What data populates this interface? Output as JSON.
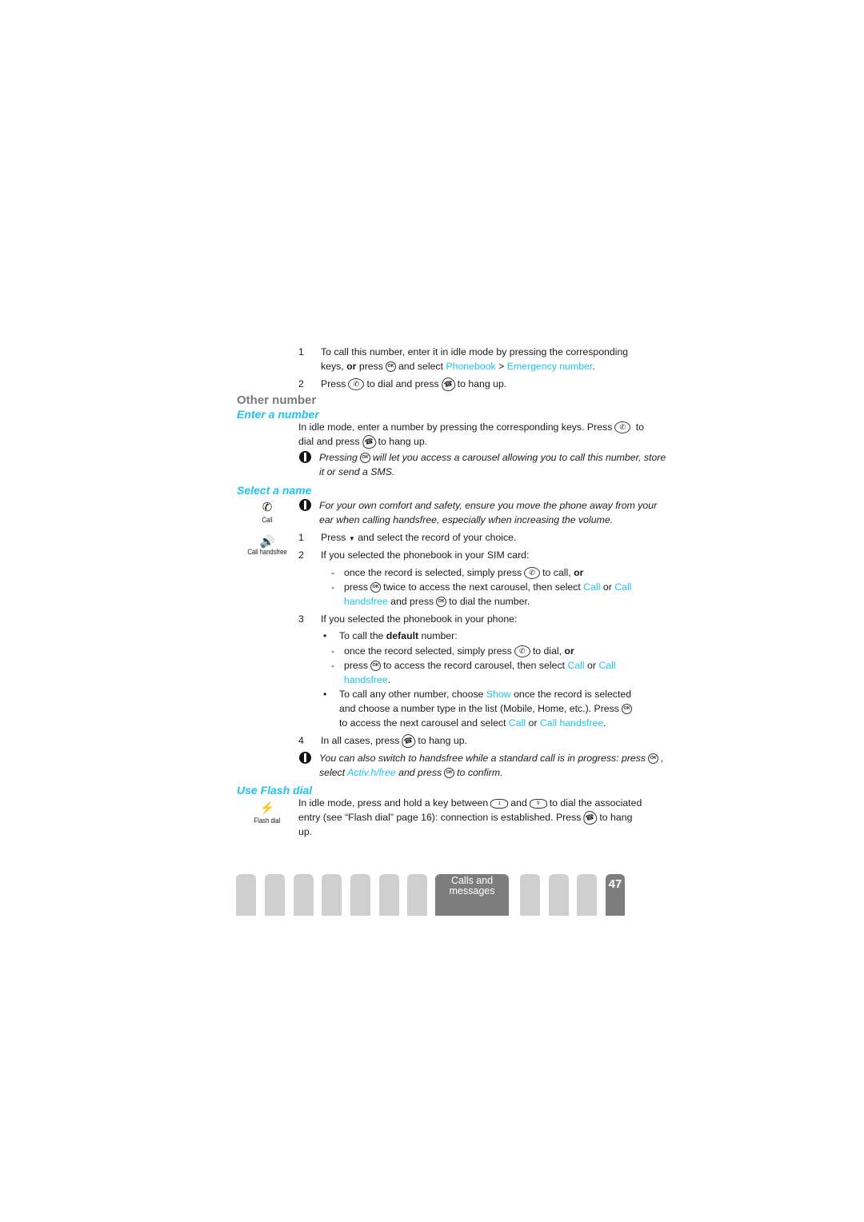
{
  "colors": {
    "accent": "#1fc3ee",
    "heading": "#7a7a7a",
    "tab": "#cfcfcf",
    "tab_active": "#7d7d7d"
  },
  "keys": {
    "ok": "OK",
    "call": "✆",
    "hang": "☎",
    "down": "▼",
    "key1": "1",
    "key9": "9"
  },
  "emergency": {
    "n1": "1",
    "s1a": "To call this number, enter it in idle mode by pressing the corresponding",
    "s1b": "keys,",
    "s1c": "or",
    "s1d": "press",
    "s1e": "and select",
    "s1f": "Phonebook",
    "s1g": ">",
    "s1h": "Emergency number",
    "s1i": ".",
    "n2": "2",
    "s2a": "Press",
    "s2b": "to dial and press",
    "s2c": "to hang up."
  },
  "other": {
    "title": "Other number",
    "enter_title": "Enter a number",
    "p1a": "In idle mode, enter a number by pressing the corresponding keys. Press",
    "p1b": "to",
    "p1c": "dial and press",
    "p1d": "to hang up.",
    "n1a": "Pressing",
    "n1b": "will let you access a carousel allowing you to call this number, store",
    "n1c": "it or send a SMS."
  },
  "select": {
    "title": "Select a name",
    "icon_call": "Call",
    "icon_handsfree": "Call handsfree",
    "note_a": "For your own comfort and safety, ensure you move the phone away from your",
    "note_b": "ear when calling handsfree, especially when increasing the volume.",
    "n1": "1",
    "s1a": "Press",
    "s1b": "and select the record of your choice.",
    "n2": "2",
    "s2": "If you selected the phonebook in your SIM card:",
    "d1a": "once the record is selected, simply press",
    "d1b": "to call,",
    "d1c": "or",
    "d2a": "press",
    "d2b": "twice to access the next carousel, then select",
    "d2c": "Call",
    "d2d": "or",
    "d2e": "Call",
    "d2f": "handsfree",
    "d2g": "and press",
    "d2h": "to  dial the number.",
    "n3": "3",
    "s3": "If you selected the phonebook in your phone:",
    "b1a": "To call the",
    "b1b": "default",
    "b1c": "number:",
    "e1a": "once the record selected, simply press",
    "e1b": "to dial,",
    "e1c": "or",
    "e2a": "press",
    "e2b": "to access the record carousel, then select",
    "e2c": "Call",
    "e2d": "or",
    "e2e": "Call",
    "e2f": "handsfree",
    "b2a": "To call any other number, choose",
    "b2b": "Show",
    "b2c": "once the record is selected",
    "b2d": "and choose a number type in the list (Mobile, Home, etc.). Press",
    "b2e": "to access the next carousel and select",
    "b2f": "Call",
    "b2g": "or",
    "b2h": "Call handsfree",
    "n4": "4",
    "s4a": "In all cases, press",
    "s4b": "to hang up.",
    "n5a": "You can also switch to handsfree while a standard call is in progress: press",
    "n5b": "select",
    "n5c": "Activ.h/free",
    "n5d": "and press",
    "n5e": "to confirm."
  },
  "flash": {
    "title": "Use Flash dial",
    "icon_label": "Flash dial",
    "a": "In idle mode, press and hold a key between",
    "b": "and",
    "c": "to dial the associated",
    "d": "entry (see “Flash dial” page 16): connection is established. Press",
    "e": "to hang",
    "f": "up."
  },
  "footer": {
    "section": "Calls and messages",
    "page": "47"
  }
}
